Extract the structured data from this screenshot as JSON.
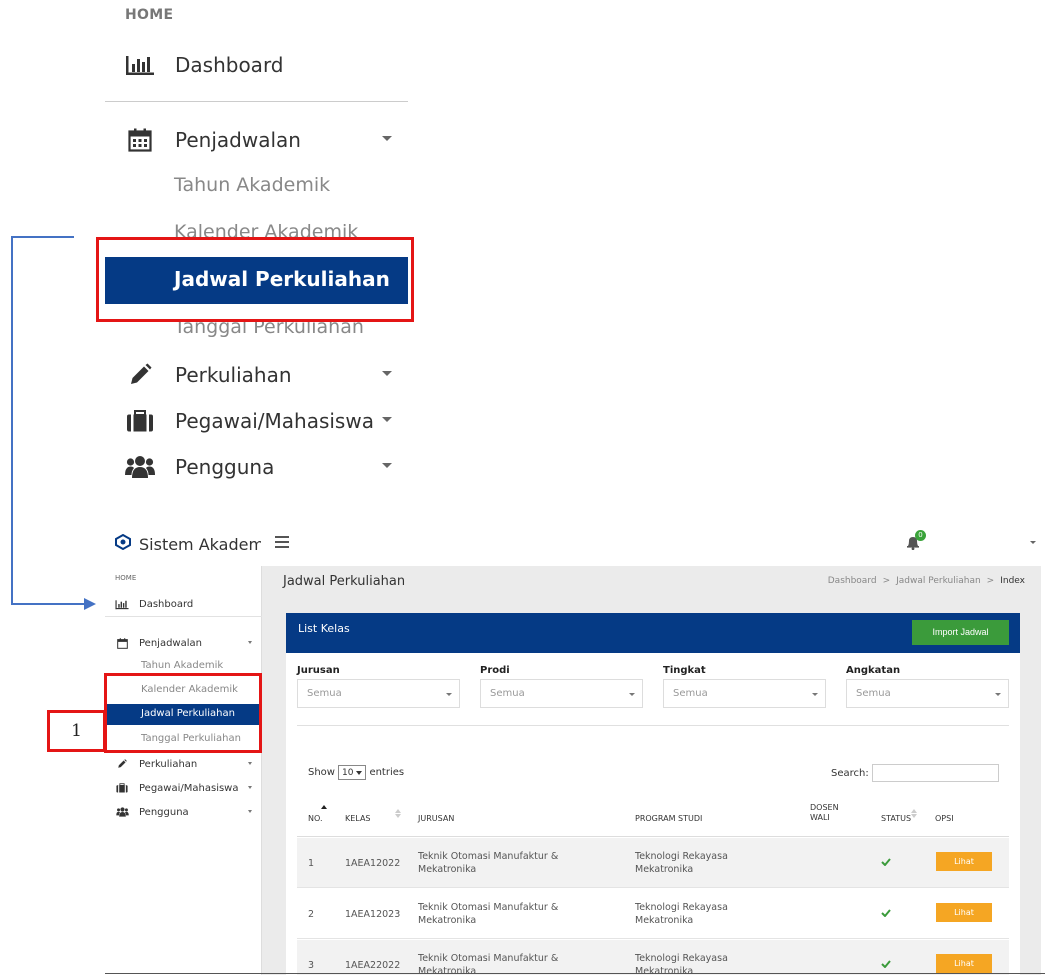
{
  "zoom_sidebar": {
    "home_label": "HOME",
    "dashboard": "Dashboard",
    "penjadwalan": "Penjadwalan",
    "sub_items": [
      "Tahun Akademik",
      "Kalender Akademik",
      "Jadwal Perkuliahan",
      "Tanggal Perkuliahan"
    ],
    "perkuliahan": "Perkuliahan",
    "pegawai": "Pegawai/Mahasiswa",
    "pengguna": "Pengguna"
  },
  "topbar": {
    "app_title": "Sistem Akademik",
    "notification_count": "0"
  },
  "sidebar": {
    "home_label": "HOME",
    "dashboard": "Dashboard",
    "penjadwalan": "Penjadwalan",
    "sub_items": [
      "Tahun Akademik",
      "Kalender Akademik",
      "Jadwal Perkuliahan",
      "Tanggal Perkuliahan"
    ],
    "perkuliahan": "Perkuliahan",
    "pegawai": "Pegawai/Mahasiswa",
    "pengguna": "Pengguna"
  },
  "page": {
    "title": "Jadwal Perkuliahan",
    "breadcrumb": [
      "Dashboard",
      "Jadwal Perkuliahan",
      "Index"
    ],
    "breadcrumb_sep": ">"
  },
  "card": {
    "title": "List Kelas",
    "import_button": "Import Jadwal"
  },
  "filters": [
    {
      "label": "Jurusan",
      "value": "Semua"
    },
    {
      "label": "Prodi",
      "value": "Semua"
    },
    {
      "label": "Tingkat",
      "value": "Semua"
    },
    {
      "label": "Angkatan",
      "value": "Semua"
    }
  ],
  "table_controls": {
    "show": "Show",
    "entries_value": "10",
    "entries": "entries",
    "search": "Search:"
  },
  "table": {
    "headers": [
      "NO.",
      "KELAS",
      "JURUSAN",
      "PROGRAM STUDI",
      "DOSEN WALI",
      "STATUS",
      "OPSI"
    ],
    "rows": [
      {
        "no": "1",
        "kelas": "1AEA12022",
        "jurusan": "Teknik Otomasi Manufaktur & Mekatronika",
        "prodi": "Teknologi Rekayasa Mekatronika",
        "dosen_wali": "",
        "action": "Lihat"
      },
      {
        "no": "2",
        "kelas": "1AEA12023",
        "jurusan": "Teknik Otomasi Manufaktur & Mekatronika",
        "prodi": "Teknologi Rekayasa Mekatronika",
        "dosen_wali": "",
        "action": "Lihat"
      },
      {
        "no": "3",
        "kelas": "1AEA22022",
        "jurusan": "Teknik Otomasi Manufaktur & Mekatronika",
        "prodi": "Teknologi Rekayasa Mekatronika",
        "dosen_wali": "",
        "action": "Lihat"
      }
    ]
  },
  "annotation": {
    "step_number": "1"
  },
  "colors": {
    "primary": "#053a85",
    "highlight_red": "#e41515",
    "connector_blue": "#4472c4",
    "success": "#3b9b3b",
    "warning": "#f5a623"
  }
}
